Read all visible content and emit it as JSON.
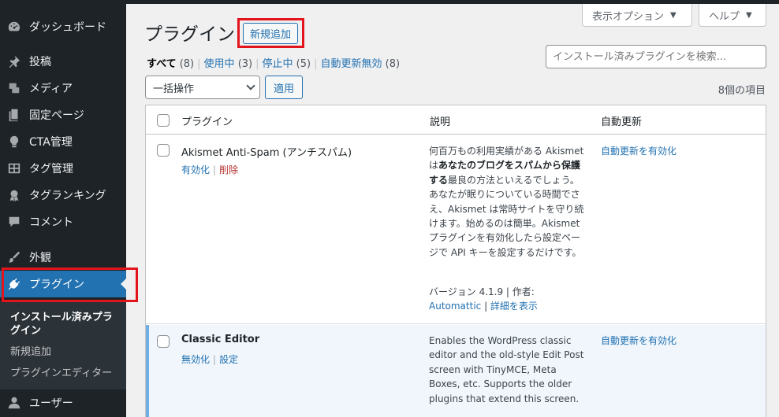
{
  "sidebar": {
    "items": [
      {
        "label": "ダッシュボード",
        "icon": "dashboard-icon"
      },
      {
        "label": "投稿",
        "icon": "pin-icon"
      },
      {
        "label": "メディア",
        "icon": "media-icon"
      },
      {
        "label": "固定ページ",
        "icon": "page-icon"
      },
      {
        "label": "CTA管理",
        "icon": "lightbulb-icon"
      },
      {
        "label": "タグ管理",
        "icon": "grid-icon"
      },
      {
        "label": "タグランキング",
        "icon": "award-icon"
      },
      {
        "label": "コメント",
        "icon": "comment-icon"
      },
      {
        "label": "外観",
        "icon": "brush-icon"
      },
      {
        "label": "プラグイン",
        "icon": "plug-icon"
      },
      {
        "label": "ユーザー",
        "icon": "user-icon"
      }
    ],
    "submenu": [
      {
        "label": "インストール済みプラグイン"
      },
      {
        "label": "新規追加"
      },
      {
        "label": "プラグインエディター"
      }
    ]
  },
  "header": {
    "title": "プラグイン",
    "add_new_label": "新規追加",
    "screen_options_label": "表示オプション",
    "help_label": "ヘルプ"
  },
  "filters": [
    {
      "label": "すべて",
      "count": "(8)"
    },
    {
      "label": "使用中",
      "count": "(3)"
    },
    {
      "label": "停止中",
      "count": "(5)"
    },
    {
      "label": "自動更新無効",
      "count": "(8)"
    }
  ],
  "search": {
    "placeholder": "インストール済みプラグインを検索..."
  },
  "bulk": {
    "selected": "一括操作",
    "apply_label": "適用",
    "item_count": "8個の項目"
  },
  "table": {
    "headers": {
      "plugin": "プラグイン",
      "description": "説明",
      "auto_update": "自動更新"
    },
    "rows": [
      {
        "name": "Akismet Anti-Spam (アンチスパム)",
        "actions": [
          "有効化",
          "削除"
        ],
        "desc_pre": "何百万もの利用実績がある Akismet は",
        "desc_bold": "あなたのブログをスパムから保護する",
        "desc_post": "最良の方法といえるでしょう。あなたが眠りについている時間でさえ、Akismet は常時サイトを守り続けます。始めるのは簡単。Akismet プラグインを有効化したら設定ページで API キーを設定するだけです。",
        "version": "バージョン 4.1.9 | 作者:",
        "author": "Automattic",
        "details": "詳細を表示",
        "auto_update": "自動更新を有効化"
      },
      {
        "name": "Classic Editor",
        "actions": [
          "無効化",
          "設定"
        ],
        "desc": "Enables the WordPress classic editor and the old-style Edit Post screen with TinyMCE, Meta Boxes, etc. Supports the older plugins that extend this screen.",
        "auto_update": "自動更新を有効化"
      }
    ]
  },
  "colors": {
    "sidebar_bg": "#1d2327",
    "accent": "#2271b1",
    "highlight_box": "#e2141c",
    "active_row_border": "#72aee6"
  }
}
